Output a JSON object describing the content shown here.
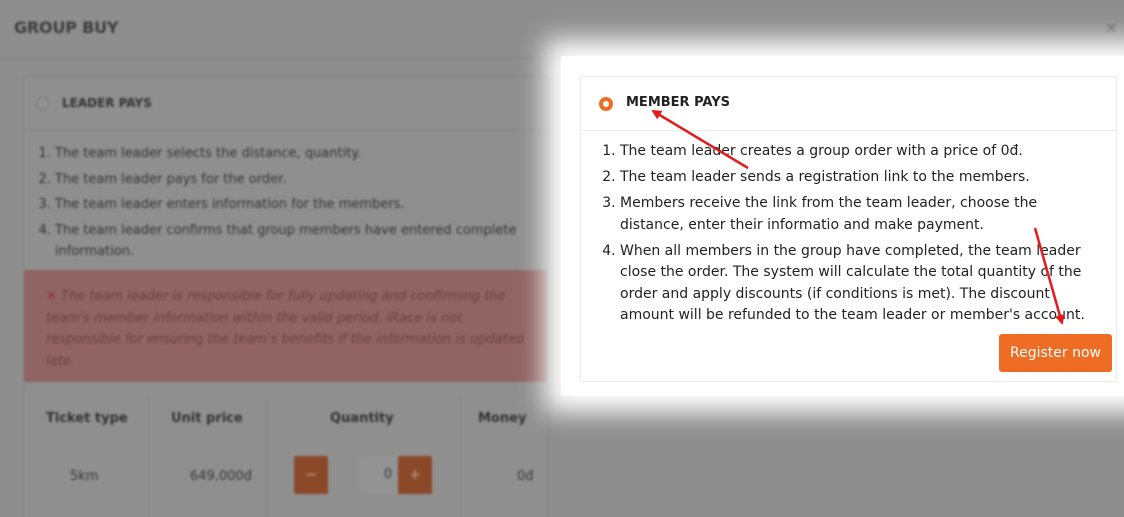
{
  "modal": {
    "title": "GROUP BUY",
    "close_label": "×"
  },
  "leader_option": {
    "label": "LEADER PAYS",
    "steps": [
      "The team leader selects the distance, quantity.",
      "The team leader pays for the order.",
      "The team leader enters information for the members.",
      "The team leader confirms that group members have entered complete information."
    ],
    "warning": "The team leader is responsible for fully updating and confirming the team's member information within the valid period. iRace is not responsible for ensuring the team's benefits if the information is updated late."
  },
  "ticket_table": {
    "headers": [
      "Ticket type",
      "Unit price",
      "Quantity",
      "Money"
    ],
    "rows": [
      {
        "ticket_type": "5km",
        "unit_price": "649,000đ",
        "quantity": "0",
        "money": "0đ"
      }
    ],
    "minus_label": "−",
    "plus_label": "+"
  },
  "member_option": {
    "label": "MEMBER PAYS",
    "selected": true,
    "steps": [
      "The team leader creates a group order with a price of 0đ.",
      "The team leader sends a registration link to the members.",
      "Members receive the link from the team leader, choose the distance, enter their informatio and make payment.",
      "When all members in the group have completed, the team leader close the order. The system will calculate the total quantity of the order and apply discounts (if conditions is met). The discount amount will be refunded to the team leader or member's account."
    ],
    "register_label": "Register now"
  },
  "colors": {
    "accent": "#ef6c24",
    "annotation_arrow": "#e41b1b"
  }
}
